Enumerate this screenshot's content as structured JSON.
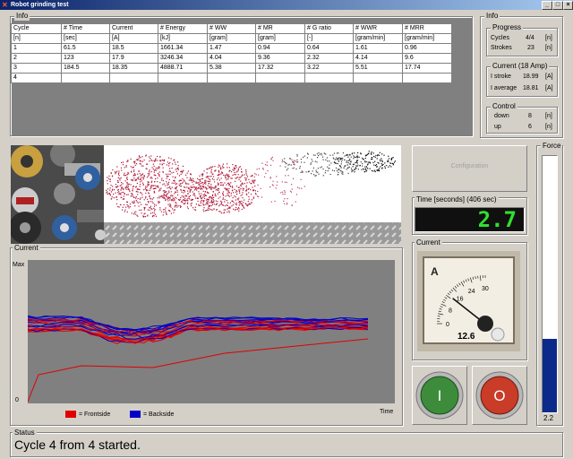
{
  "window": {
    "title": "Robot grinding test"
  },
  "info": {
    "legend": "Info",
    "columns": [
      "Cycle",
      "# Time",
      "Current",
      "# Energy",
      "# WW",
      "# MR",
      "# G ratio",
      "# WWR",
      "# MRR"
    ],
    "units": [
      "[n]",
      "[sec]",
      "[A]",
      "[kJ]",
      "[gram]",
      "[gram]",
      "[-]",
      "[gram/min]",
      "[gram/min]"
    ],
    "rows": [
      [
        "1",
        "61.5",
        "18.5",
        "1661.34",
        "1.47",
        "0.94",
        "0.64",
        "1.61",
        "0.96"
      ],
      [
        "2",
        "123",
        "17.9",
        "3246.34",
        "4.04",
        "9.36",
        "2.32",
        "4.14",
        "9.6"
      ],
      [
        "3",
        "184.5",
        "18.35",
        "4888.71",
        "5.38",
        "17.32",
        "3.22",
        "5.51",
        "17.74"
      ],
      [
        "4",
        "",
        "",
        "",
        "",
        "",
        "",
        "",
        ""
      ]
    ]
  },
  "side_info": {
    "legend": "Info",
    "progress": {
      "legend": "Progress",
      "cycles_label": "Cycles",
      "cycles_value": "4/4",
      "cycles_unit": "[n]",
      "strokes_label": "Strokes",
      "strokes_value": "23",
      "strokes_unit": "[n]"
    },
    "current": {
      "legend": "Current (18 Amp)",
      "istroke_label": "I stroke",
      "istroke_value": "18.99",
      "istroke_unit": "[A]",
      "iavg_label": "I average",
      "iavg_value": "18.81",
      "iavg_unit": "[A]"
    },
    "control": {
      "legend": "Control",
      "down_label": "down",
      "down_value": "8",
      "down_unit": "[n]",
      "up_label": "up",
      "up_value": "6",
      "up_unit": "[n]"
    }
  },
  "configuration_button": "Configuration",
  "time": {
    "legend": "Time [seconds] (406 sec)",
    "value": "2.7"
  },
  "current_meter": {
    "legend": "Current",
    "unit_label": "A",
    "ticks": [
      "0",
      "8",
      "16",
      "24",
      "30"
    ],
    "reading": "12.6",
    "fraction": 0.42
  },
  "force": {
    "legend": "Force",
    "value": "2.2",
    "fill_fraction": 0.29
  },
  "current_chart": {
    "legend": "Current",
    "ymax_label": "Max",
    "ymin_label": "0",
    "xlabel": "Time",
    "legend_front": "= Frontside",
    "legend_back": "= Backside",
    "front_color": "#e00000",
    "back_color": "#0000c8"
  },
  "start_button": {
    "glyph": "I",
    "color": "#3c8c3c"
  },
  "stop_button": {
    "glyph": "O",
    "color": "#c83c28"
  },
  "status": {
    "legend": "Status",
    "message": "Cycle 4 from 4 started."
  }
}
